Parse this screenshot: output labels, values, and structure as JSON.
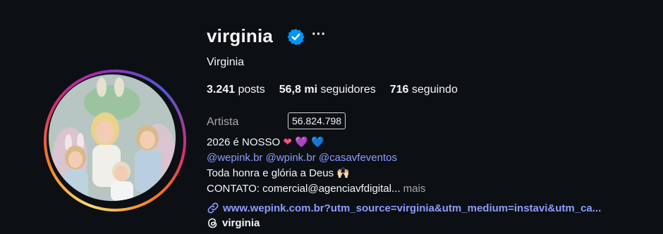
{
  "profile": {
    "username": "virginia",
    "more_label": "···",
    "full_name": "Virginia",
    "category": "Artista"
  },
  "stats": {
    "posts_count": "3.241",
    "posts_label": "posts",
    "followers_count": "56,8 mi",
    "followers_label": "seguidores",
    "following_count": "716",
    "following_label": "seguindo"
  },
  "tooltip": {
    "exact_followers": "56.824.798"
  },
  "bio": {
    "line1_text": "2026 é NOSSO",
    "line1_emojis": [
      "❤",
      "💜",
      "💙"
    ],
    "mentions": [
      "@wepink.br",
      "@wpink.br",
      "@casavfeventos"
    ],
    "line3_text": "Toda honra e glória a Deus",
    "line3_emoji": "🙌🏻",
    "line4_text": "CONTATO: comercial@agenciavfdigital...",
    "more_label": "mais"
  },
  "link": {
    "text": "www.wepink.com.br?utm_source=virginia&utm_medium=instavi&utm_ca..."
  },
  "threads": {
    "handle": "virginia"
  },
  "colors": {
    "background": "#0c1014",
    "link": "#8c9cff",
    "muted": "#a8a8a8",
    "verified": "#0095f6"
  },
  "icons": {
    "verified": "verified-badge-icon",
    "link": "link-icon",
    "threads": "threads-icon"
  }
}
